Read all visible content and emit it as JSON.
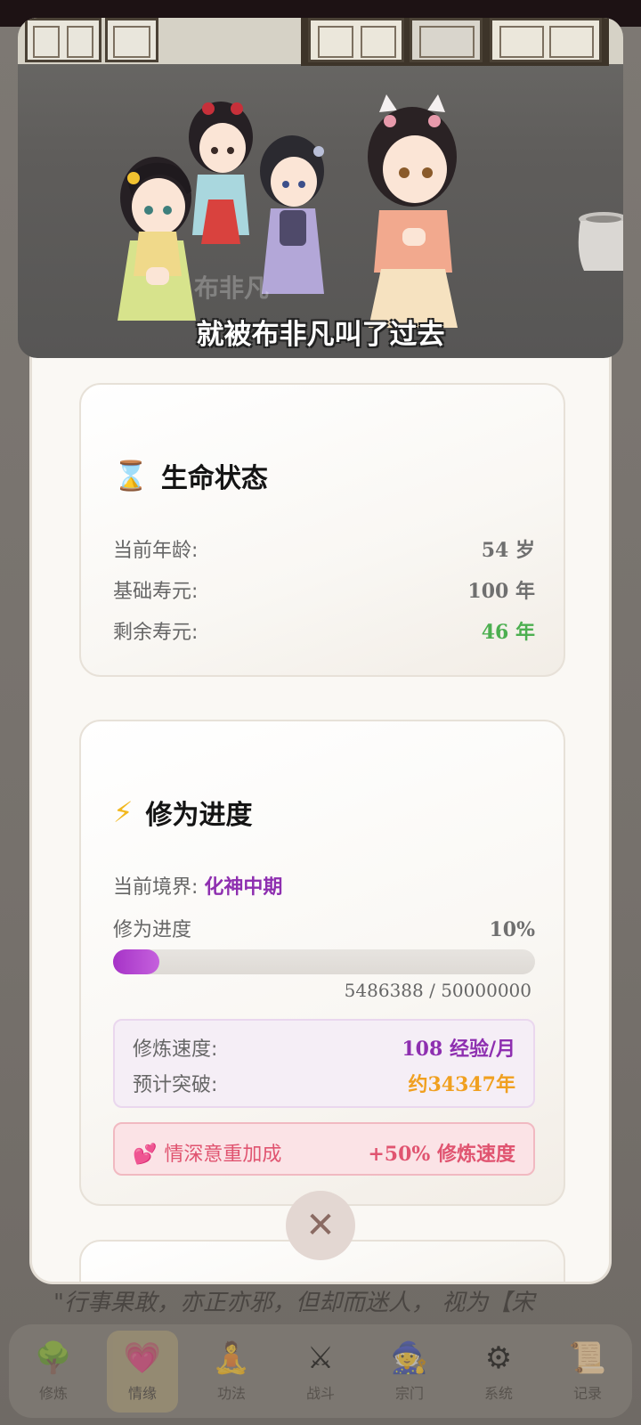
{
  "video": {
    "subtitle": "就被布非凡叫了过去",
    "watermark": "布非凡"
  },
  "life_card": {
    "icon": "⌛",
    "title": "生命状态",
    "rows": [
      {
        "label": "当前年龄:",
        "value": "54 岁",
        "color": "#6f6f6f"
      },
      {
        "label": "基础寿元:",
        "value": "100 年",
        "color": "#6f6f6f"
      },
      {
        "label": "剩余寿元:",
        "value": "46 年",
        "color": "#4caf50"
      }
    ]
  },
  "cultivation_card": {
    "icon": "⚡",
    "title": "修为进度",
    "realm_label": "当前境界:",
    "realm_value": "化神中期",
    "progress_label": "修为进度",
    "progress_percent_text": "10%",
    "progress_fraction": 0.11,
    "exp_text": "5486388 / 50000000",
    "speed_label": "修炼速度:",
    "speed_value": "108 经验/月",
    "breakthrough_label": "预计突破:",
    "breakthrough_value": "约34347年",
    "bonus_icon": "💕",
    "bonus_label": "情深意重加成",
    "bonus_value": "+50% 修炼速度"
  },
  "background": {
    "story_text": "\"行事果敢，亦正亦邪，但却而迷人，   视为【宋"
  },
  "bottom_nav": [
    {
      "icon": "🌳",
      "label": "修炼",
      "active": false
    },
    {
      "icon": "💗",
      "label": "情缘",
      "active": true
    },
    {
      "icon": "🧘",
      "label": "功法",
      "active": false
    },
    {
      "icon": "⚔",
      "label": "战斗",
      "active": false
    },
    {
      "icon": "🧙",
      "label": "宗门",
      "active": false
    },
    {
      "icon": "⚙",
      "label": "系统",
      "active": false
    },
    {
      "icon": "📜",
      "label": "记录",
      "active": false
    }
  ],
  "close_button": {
    "icon": "✕"
  },
  "colors": {
    "accent_purple": "#8e2fb0",
    "green": "#4caf50",
    "orange": "#f0a020",
    "pink": "#e05470"
  }
}
